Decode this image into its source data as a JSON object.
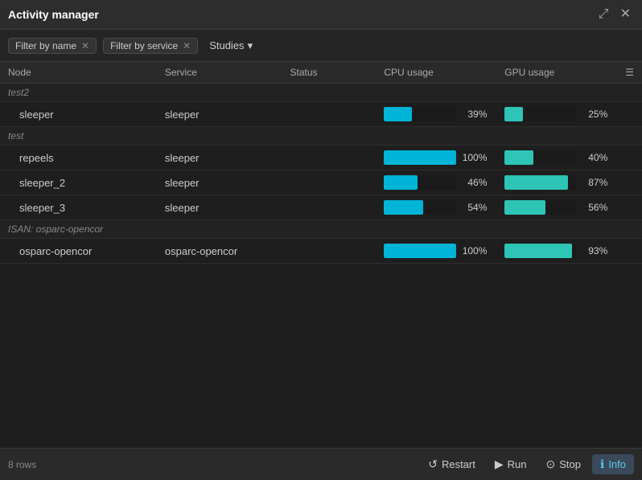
{
  "titleBar": {
    "title": "Activity manager",
    "expandIcon": "⤢",
    "closeIcon": "✕"
  },
  "filters": {
    "byName": {
      "label": "Filter by name",
      "active": true
    },
    "byService": {
      "label": "Filter by service",
      "active": true
    },
    "studies": {
      "label": "Studies",
      "hasDropdown": true
    }
  },
  "table": {
    "columns": [
      {
        "key": "node",
        "label": "Node"
      },
      {
        "key": "service",
        "label": "Service"
      },
      {
        "key": "status",
        "label": "Status"
      },
      {
        "key": "cpu",
        "label": "CPU usage"
      },
      {
        "key": "gpu",
        "label": "GPU usage"
      },
      {
        "key": "menu",
        "label": "⋮"
      }
    ],
    "groups": [
      {
        "groupLabel": "test2",
        "rows": [
          {
            "node": "sleeper",
            "service": "sleeper",
            "status": "",
            "cpu": 39,
            "gpu": 25
          }
        ]
      },
      {
        "groupLabel": "test",
        "rows": [
          {
            "node": "repeels",
            "service": "sleeper",
            "status": "",
            "cpu": 100,
            "gpu": 40
          },
          {
            "node": "sleeper_2",
            "service": "sleeper",
            "status": "",
            "cpu": 46,
            "gpu": 87
          },
          {
            "node": "sleeper_3",
            "service": "sleeper",
            "status": "",
            "cpu": 54,
            "gpu": 56
          }
        ]
      },
      {
        "groupLabel": "ISAN: osparc-opencor",
        "rows": [
          {
            "node": "osparc-opencor",
            "service": "osparc-opencor",
            "status": "",
            "cpu": 100,
            "gpu": 93
          }
        ]
      }
    ]
  },
  "bottomBar": {
    "rowCount": "8 rows",
    "restartLabel": "Restart",
    "runLabel": "Run",
    "stopLabel": "Stop",
    "infoLabel": "Info"
  }
}
